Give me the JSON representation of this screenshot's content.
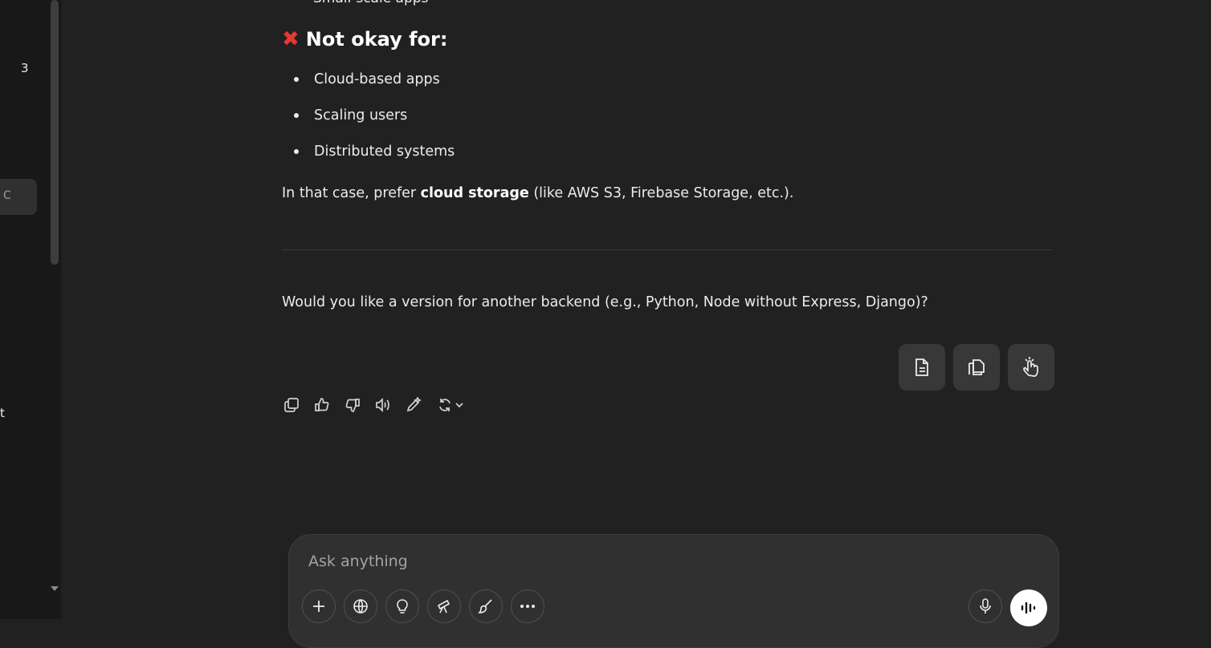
{
  "sidebar": {
    "visible_number": "3",
    "active_item_fragment": "C",
    "lower_item_fragment": "t"
  },
  "message": {
    "partial_item": "Small-scale apps",
    "heading_icon": "cross-mark-icon",
    "heading": "Not okay for:",
    "items": [
      "Cloud-based apps",
      "Scaling users",
      "Distributed systems"
    ],
    "paragraph": {
      "before": "In that case, prefer ",
      "bold": "cloud storage",
      "after": " (like AWS S3, Firebase Storage, etc.)."
    },
    "question": "Would you like a version for another backend (e.g., Python, Node without Express, Django)?"
  },
  "floating_actions": [
    "document-icon",
    "copy-pages-icon",
    "pointer-hand-icon"
  ],
  "message_actions": [
    "copy-icon",
    "thumbs-up-icon",
    "thumbs-down-icon",
    "read-aloud-icon",
    "edit-icon",
    "regenerate-icon",
    "chevron-down-icon"
  ],
  "composer": {
    "placeholder": "Ask anything",
    "tools": [
      "plus-icon",
      "globe-icon",
      "lightbulb-icon",
      "telescope-icon",
      "paintbrush-icon",
      "more-icon"
    ],
    "mic_icon": "microphone-icon",
    "voice_icon": "voice-mode-icon"
  },
  "colors": {
    "background": "#212121",
    "sidebar": "#181818",
    "composer": "#303030",
    "cross": "#e53935"
  }
}
